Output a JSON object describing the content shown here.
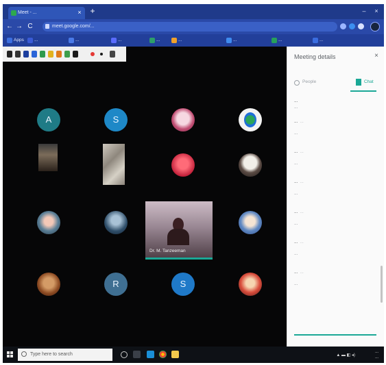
{
  "browser": {
    "tab_title": "Meet - ...",
    "tab_close": "×",
    "new_tab": "+",
    "minimize": "–",
    "close": "×",
    "back": "←",
    "forward": "→",
    "reload": "C",
    "url": "meet.google.com/..."
  },
  "bookmarks": [
    {
      "label": "Apps",
      "color": "#3c6fe0"
    },
    {
      "label": "...",
      "color": "#3a5bd6"
    },
    {
      "label": "...",
      "color": "#4a7ae8"
    },
    {
      "label": "...",
      "color": "#5a6cff"
    },
    {
      "label": "...",
      "color": "#2d9f6a"
    },
    {
      "label": "...",
      "color": "#f1a12a"
    },
    {
      "label": "...",
      "color": "#3f8cf0"
    },
    {
      "label": "...",
      "color": "#27a05a"
    },
    {
      "label": "...",
      "color": "#3a6de0"
    }
  ],
  "participants": {
    "a": {
      "initial": "A",
      "color": "#1f7b86"
    },
    "s1": {
      "initial": "S",
      "color": "#1e88c7"
    },
    "r": {
      "initial": "R",
      "color": "#3f6f92"
    },
    "s2": {
      "initial": "S",
      "color": "#1f79c8"
    }
  },
  "speaker": {
    "name": "Dr. M. Tanzeeman"
  },
  "panel": {
    "title": "Meeting details",
    "close": "×",
    "tab_people": "People",
    "tab_chat": "Chat",
    "accent": "#1aa896",
    "messages": [
      {
        "sender": "...",
        "time": "",
        "text": "..."
      },
      {
        "sender": "...",
        "time": "...",
        "text": "..."
      },
      {
        "sender": "...",
        "time": "...",
        "text": "..."
      },
      {
        "sender": "...",
        "time": "...",
        "text": "..."
      },
      {
        "sender": "...",
        "time": "...",
        "text": "..."
      },
      {
        "sender": "...",
        "time": "...",
        "text": "..."
      },
      {
        "sender": "...",
        "time": "...",
        "text": "..."
      }
    ]
  },
  "taskbar": {
    "search_placeholder": "Type here to search",
    "time": "...",
    "date": "..."
  }
}
